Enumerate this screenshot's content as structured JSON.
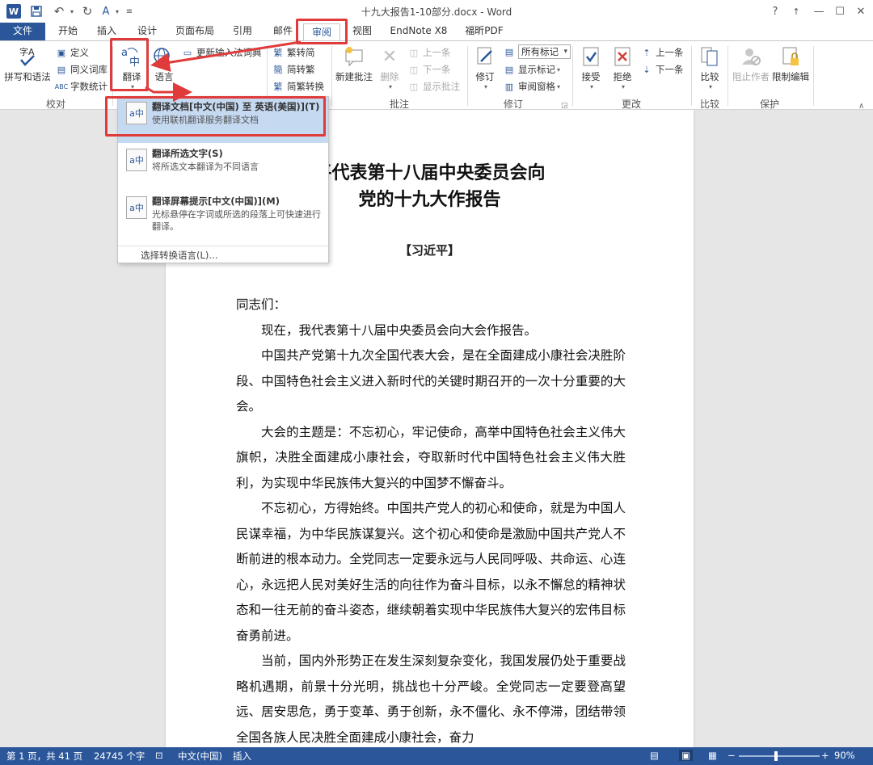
{
  "app": {
    "title": "十九大报告1-10部分.docx - Word",
    "logo": "W"
  },
  "qat": {
    "save_icon": "save-icon",
    "undo_icon": "undo-icon",
    "redo_icon": "redo-icon",
    "format_icon": "format-painter-icon"
  },
  "window": {
    "help": "?",
    "restore_ribbon": "↑",
    "minimize": "—",
    "maximize": "☐",
    "close": "✕"
  },
  "tabs": [
    "文件",
    "开始",
    "插入",
    "设计",
    "页面布局",
    "引用",
    "邮件",
    "审阅",
    "视图",
    "EndNote X8",
    "福昕PDF"
  ],
  "ribbon": {
    "proofing": {
      "spell": "拼写和语法",
      "define": "定义",
      "thesaurus": "同义词库",
      "word_count": "字数统计",
      "label": "校对"
    },
    "language": {
      "translate": "翻译",
      "language": "语言",
      "update_ime": "更新输入法词典"
    },
    "chinese": {
      "to_simplified": "繁转简",
      "to_traditional": "简转繁",
      "convert": "简繁转换"
    },
    "comments": {
      "new": "新建批注",
      "delete": "删除",
      "prev": "上一条",
      "next": "下一条",
      "show": "显示批注",
      "label": "批注"
    },
    "tracking": {
      "track": "修订",
      "all_markup": "所有标记",
      "show_markup": "显示标记",
      "pane": "审阅窗格",
      "label": "修订"
    },
    "changes": {
      "accept": "接受",
      "reject": "拒绝",
      "prev": "上一条",
      "next": "下一条",
      "label": "更改"
    },
    "compare": {
      "compare": "比较",
      "label": "比较"
    },
    "protect": {
      "block": "阻止作者",
      "restrict": "限制编辑",
      "label": "保护"
    }
  },
  "menu": {
    "translate_doc": {
      "title": "翻译文档[中文(中国) 至 英语(美国)](T)",
      "desc": "使用联机翻译服务翻译文档"
    },
    "translate_sel": {
      "title": "翻译所选文字(S)",
      "desc": "将所选文本翻译为不同语言"
    },
    "mini_translator": {
      "title": "翻译屏幕提示[中文(中国)](M)",
      "desc": "光标悬停在字词或所选的段落上可快速进行翻译。"
    },
    "choose_lang": "选择转换语言(L)..."
  },
  "document": {
    "heading_line1": "平代表第十八届中央委员会向",
    "heading_line2": "党的十九大作报告",
    "author": "【习近平】",
    "paragraphs": [
      "同志们：",
      "现在，我代表第十八届中央委员会向大会作报告。",
      "中国共产党第十九次全国代表大会，是在全面建成小康社会决胜阶段、中国特色社会主义进入新时代的关键时期召开的一次十分重要的大会。",
      "大会的主题是：不忘初心，牢记使命，高举中国特色社会主义伟大旗帜，决胜全面建成小康社会，夺取新时代中国特色社会主义伟大胜利，为实现中华民族伟大复兴的中国梦不懈奋斗。",
      "不忘初心，方得始终。中国共产党人的初心和使命，就是为中国人民谋幸福，为中华民族谋复兴。这个初心和使命是激励中国共产党人不断前进的根本动力。全党同志一定要永远与人民同呼吸、共命运、心连心，永远把人民对美好生活的向往作为奋斗目标，以永不懈怠的精神状态和一往无前的奋斗姿态，继续朝着实现中华民族伟大复兴的宏伟目标奋勇前进。",
      "当前，国内外形势正在发生深刻复杂变化，我国发展仍处于重要战略机遇期，前景十分光明，挑战也十分严峻。全党同志一定要登高望远、居安思危，勇于变革、勇于创新，永不僵化、永不停滞，团结带领全国各族人民决胜全面建成小康社会，奋力"
    ]
  },
  "status": {
    "page": "第 1 页，共 41 页",
    "words": "24745 个字",
    "language": "中文(中国)",
    "mode": "插入",
    "zoom": "90%"
  },
  "colors": {
    "accent": "#2b579a",
    "highlight": "#e03b3b",
    "menu_hover": "#c5d9f1"
  }
}
